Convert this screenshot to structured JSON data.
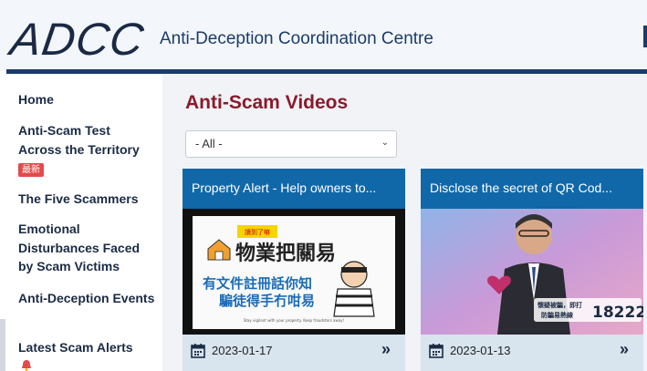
{
  "header": {
    "logo_text": "ADCC",
    "org_name": "Anti-Deception Coordination Centre"
  },
  "sidebar": {
    "items": [
      {
        "label": "Home"
      },
      {
        "label": "Anti-Scam Test Across the Territory",
        "badge": "最新"
      },
      {
        "label": "The Five Scammers"
      },
      {
        "label": "Emotional Disturbances Faced by Scam Victims"
      },
      {
        "label": "Anti-Deception Events"
      },
      {
        "label": "Latest Scam Alerts"
      }
    ]
  },
  "main": {
    "title": "Anti-Scam Videos",
    "filter": {
      "selected": "- All -"
    },
    "cards": [
      {
        "title": "Property Alert - Help owners to...",
        "date": "2023-01-17",
        "image_text": {
          "tag": "讀到了嘛",
          "line1": "物業把關易",
          "line2": "有文件註冊話你知",
          "line3": "騙徒得手冇咁易",
          "caption": "Stay vigilant with your property. Keep fraudsters away!"
        }
      },
      {
        "title": "Disclose the secret of QR Cod...",
        "date": "2023-01-13",
        "image_text": {
          "line1": "懷疑被騙，即打",
          "line2": "防騙易熱線",
          "hotline": "18222"
        }
      }
    ]
  },
  "colors": {
    "brand_navy": "#1b3c6b",
    "title_red": "#8b1a2b",
    "card_header_blue": "#1168a8",
    "badge_red": "#e34a4a"
  },
  "icons": {
    "calendar": "calendar-icon",
    "more": "double-chevron-right-icon",
    "select": "chevron-down-icon"
  }
}
